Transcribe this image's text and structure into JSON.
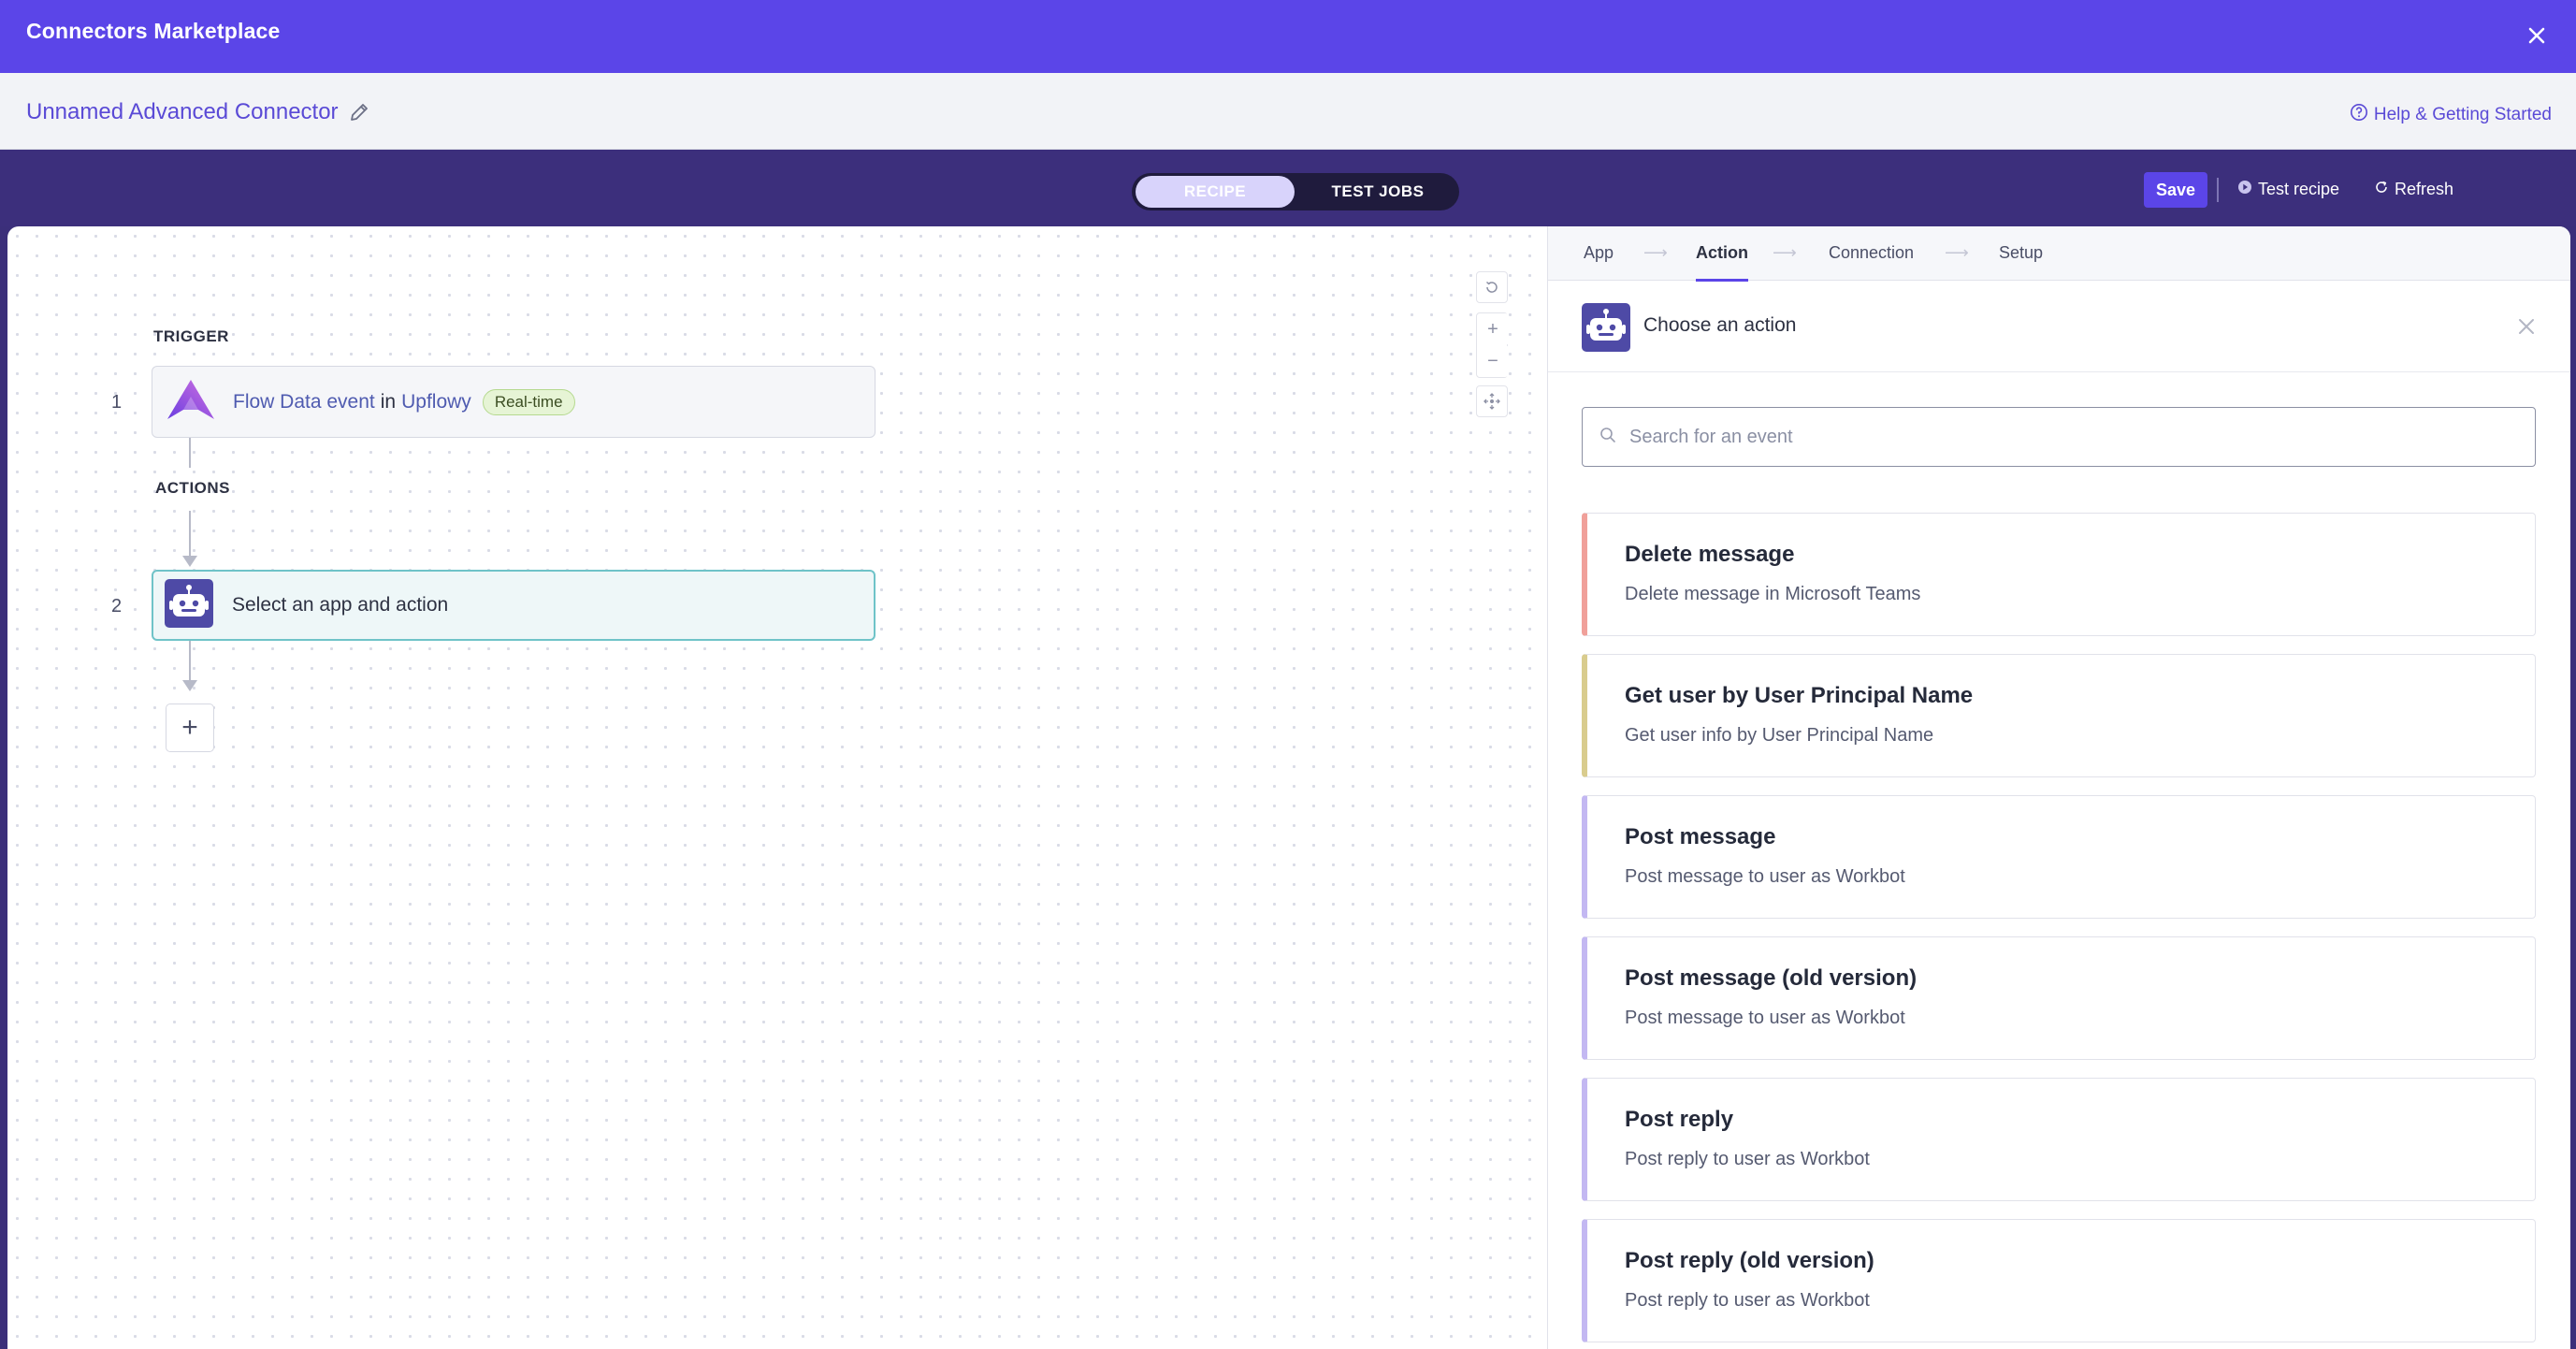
{
  "app": {
    "title": "Connectors Marketplace"
  },
  "connector": {
    "name": "Unnamed Advanced Connector",
    "help_label": "Help & Getting Started"
  },
  "toolbar": {
    "tab_recipe": "RECIPE",
    "tab_test_jobs": "TEST JOBS",
    "save_label": "Save",
    "test_recipe_label": "Test recipe",
    "refresh_label": "Refresh"
  },
  "flow": {
    "trigger_label": "TRIGGER",
    "actions_label": "ACTIONS",
    "step1": {
      "number": "1",
      "event": "Flow Data event",
      "in": "in",
      "app": "Upflowy",
      "badge": "Real-time"
    },
    "step2": {
      "number": "2",
      "text": "Select an app and action"
    }
  },
  "wizard": {
    "steps": [
      "App",
      "Action",
      "Connection",
      "Setup"
    ],
    "active": "Action"
  },
  "panel": {
    "choose_title": "Choose an action",
    "search_placeholder": "Search for an event",
    "actions": [
      {
        "title": "Delete message",
        "desc": "Delete message in Microsoft Teams",
        "color": "#f0a09a"
      },
      {
        "title": "Get user by User Principal Name",
        "desc": "Get user info by User Principal Name",
        "color": "#d9cc8e"
      },
      {
        "title": "Post message",
        "desc": "Post message to user as Workbot",
        "color": "#c3b8f2"
      },
      {
        "title": "Post message (old version)",
        "desc": "Post message to user as Workbot",
        "color": "#c3b8f2"
      },
      {
        "title": "Post reply",
        "desc": "Post reply to user as Workbot",
        "color": "#c3b8f2"
      },
      {
        "title": "Post reply (old version)",
        "desc": "Post reply to user as Workbot",
        "color": "#c3b8f2"
      }
    ]
  },
  "colors": {
    "brand": "#5b45e8",
    "toolbar": "#3c2f7c",
    "accent_teal": "#6fc3c8"
  },
  "icons": [
    "close-icon",
    "pencil-icon",
    "help-circle-icon",
    "play-icon",
    "refresh-icon",
    "reset-icon",
    "zoom-in-icon",
    "zoom-out-icon",
    "fit-icon",
    "upflowy-logo-icon",
    "workbot-icon",
    "search-icon",
    "plus-icon"
  ]
}
